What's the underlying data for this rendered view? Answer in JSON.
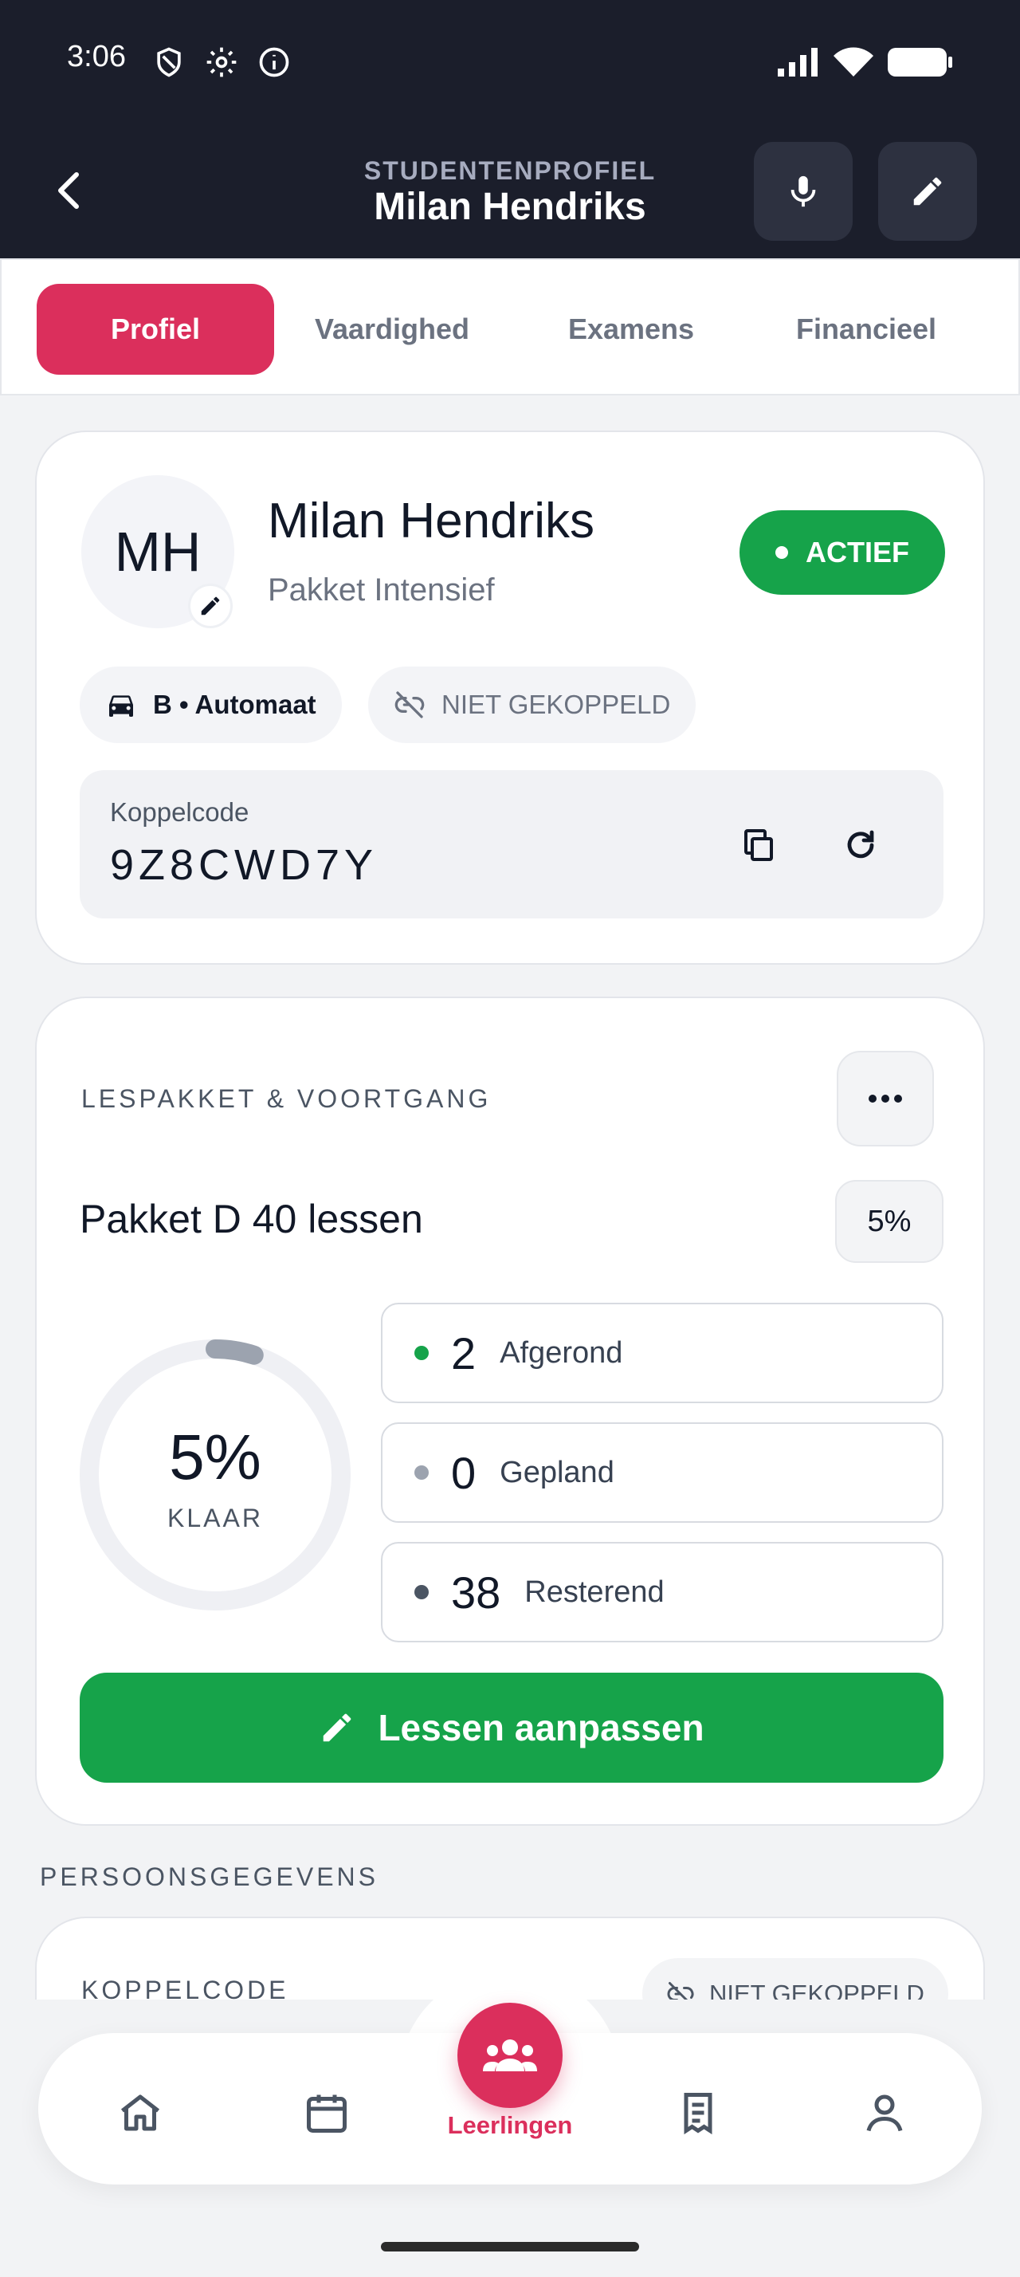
{
  "status_bar": {
    "time": "3:06"
  },
  "header": {
    "subtitle": "STUDENTENPROFIEL",
    "title": "Milan Hendriks"
  },
  "tabs": [
    {
      "label": "Profiel",
      "active": true
    },
    {
      "label": "Vaardighed",
      "active": false
    },
    {
      "label": "Examens",
      "active": false
    },
    {
      "label": "Financieel",
      "active": false
    }
  ],
  "profile": {
    "initials": "MH",
    "name": "Milan Hendriks",
    "package": "Pakket Intensief",
    "status": "ACTIEF",
    "license_chip": "B • Automaat",
    "link_chip": "NIET GEKOPPELD",
    "koppelcode_label": "Koppelcode",
    "koppelcode_value": "9Z8CWD7Y"
  },
  "progress": {
    "section_label": "LESPAKKET & VOORTGANG",
    "package_name": "Pakket D 40 lessen",
    "percent_chip": "5%",
    "donut_percent": "5%",
    "donut_label": "KLAAR",
    "completed_fraction": 0.05,
    "stats": [
      {
        "count": "2",
        "label": "Afgerond",
        "color": "#16a34a"
      },
      {
        "count": "0",
        "label": "Gepland",
        "color": "#9ca3af"
      },
      {
        "count": "38",
        "label": "Resterend",
        "color": "#4b5563"
      }
    ],
    "edit_button": "Lessen aanpassen"
  },
  "personal": {
    "section_label": "PERSOONSGEGEVENS",
    "koppelcode_label": "KOPPELCODE",
    "link_chip": "NIET GEKOPPELD"
  },
  "bottom_nav": {
    "items": [
      {
        "icon": "home-icon"
      },
      {
        "icon": "calendar-icon"
      },
      {
        "icon": "students-icon",
        "label": "Leerlingen",
        "active": true
      },
      {
        "icon": "receipt-icon"
      },
      {
        "icon": "profile-icon"
      }
    ]
  },
  "colors": {
    "accent": "#db2f5c",
    "success": "#16a34a",
    "header_bg": "#1b1e2b"
  }
}
